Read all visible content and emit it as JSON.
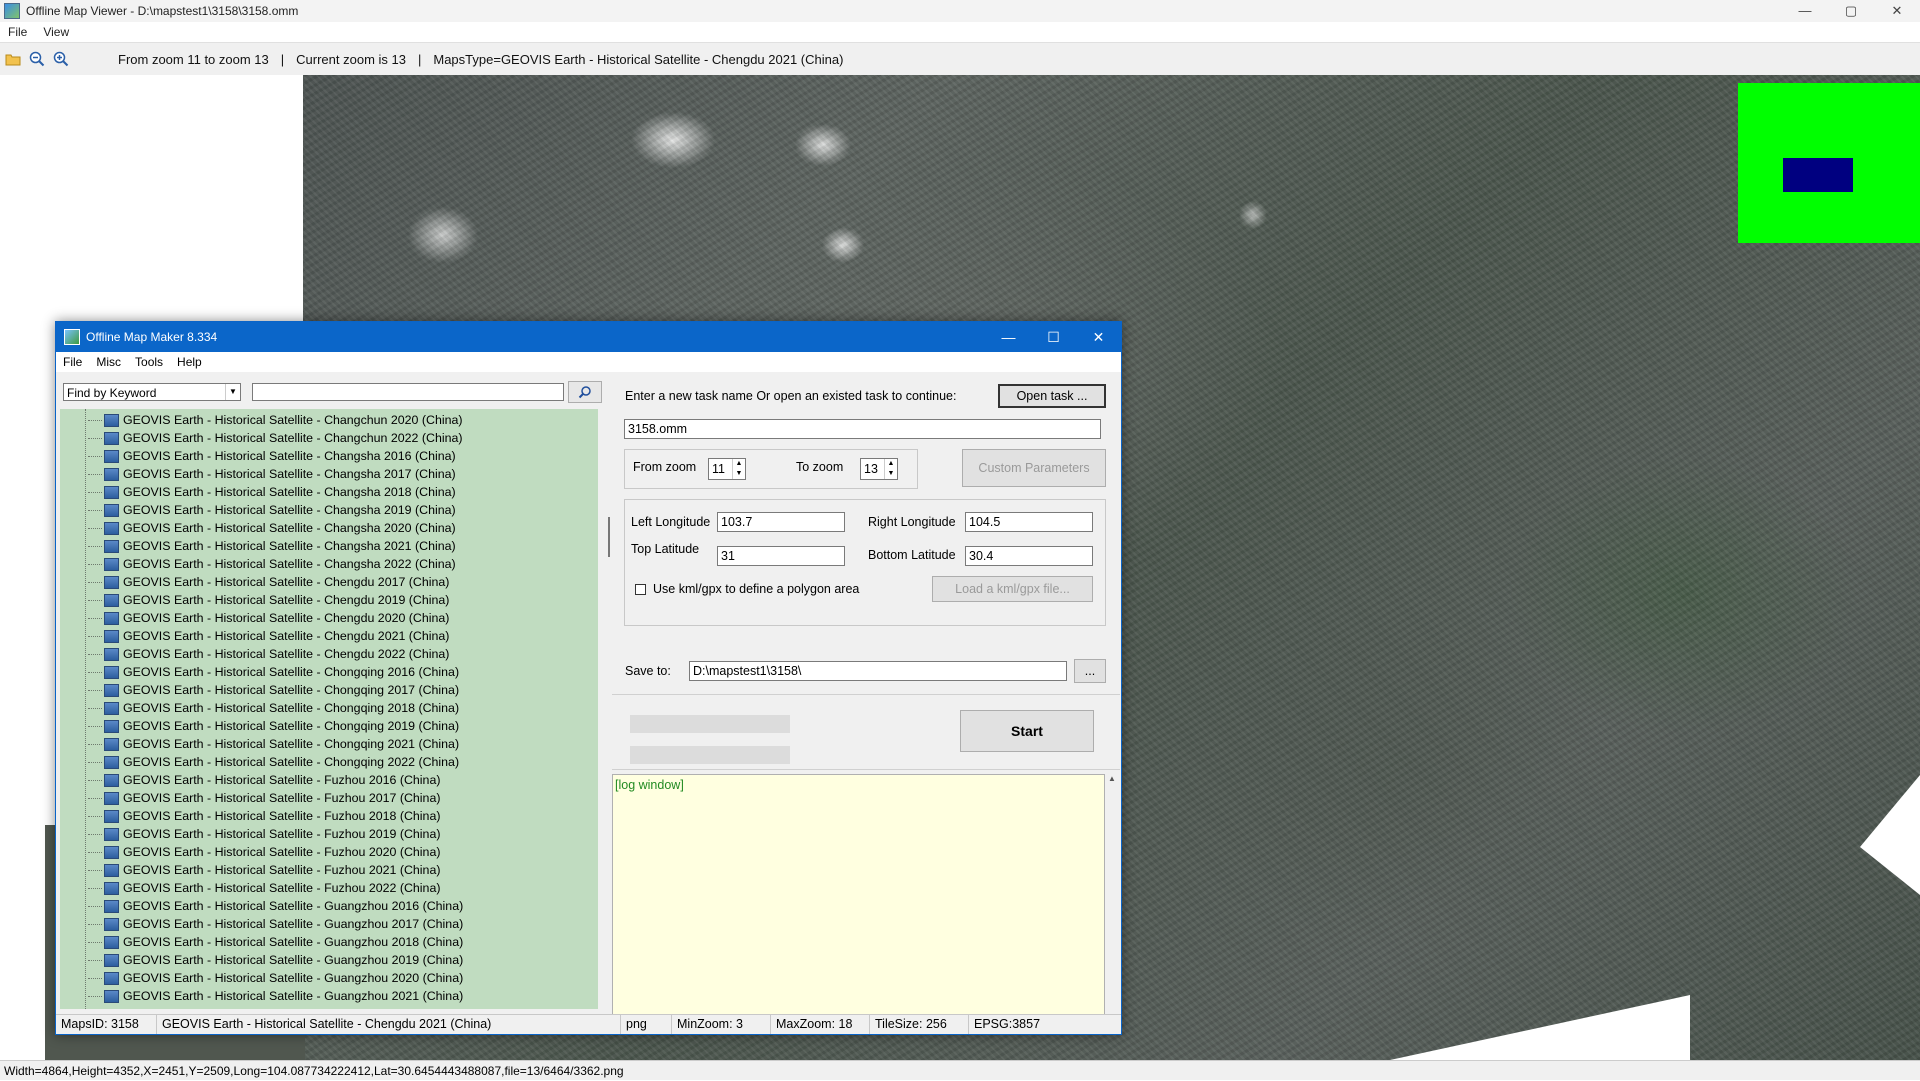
{
  "viewer": {
    "title": "Offline Map Viewer - D:\\mapstest1\\3158\\3158.omm",
    "menu": [
      "File",
      "View"
    ],
    "window_controls": {
      "minimize": "—",
      "maximize": "▢",
      "close": "✕"
    },
    "toolbar": {
      "zoom_range": "From zoom 11 to zoom 13",
      "current_zoom": "Current zoom is 13",
      "maps_type": "MapsType=GEOVIS Earth - Historical Satellite - Chengdu 2021 (China)",
      "separator": "|"
    },
    "status": "Width=4864,Height=4352,X=2451,Y=2509,Long=104.087734222412,Lat=30.6454443488087,file=13/6464/3362.png",
    "overview_colors": {
      "background": "#00ff00",
      "viewport": "#000080"
    }
  },
  "maker": {
    "title": "Offline Map Maker 8.334",
    "menu": [
      "File",
      "Misc",
      "Tools",
      "Help"
    ],
    "window_controls": {
      "minimize": "—",
      "maximize": "☐",
      "close": "✕"
    },
    "search": {
      "mode": "Find by Keyword",
      "query": ""
    },
    "map_list": [
      "GEOVIS Earth - Historical Satellite - Changchun 2020 (China)",
      "GEOVIS Earth - Historical Satellite - Changchun 2022 (China)",
      "GEOVIS Earth - Historical Satellite - Changsha 2016 (China)",
      "GEOVIS Earth - Historical Satellite - Changsha 2017 (China)",
      "GEOVIS Earth - Historical Satellite - Changsha 2018 (China)",
      "GEOVIS Earth - Historical Satellite - Changsha 2019 (China)",
      "GEOVIS Earth - Historical Satellite - Changsha 2020 (China)",
      "GEOVIS Earth - Historical Satellite - Changsha 2021 (China)",
      "GEOVIS Earth - Historical Satellite - Changsha 2022 (China)",
      "GEOVIS Earth - Historical Satellite - Chengdu 2017 (China)",
      "GEOVIS Earth - Historical Satellite - Chengdu 2019 (China)",
      "GEOVIS Earth - Historical Satellite - Chengdu 2020 (China)",
      "GEOVIS Earth - Historical Satellite - Chengdu 2021 (China)",
      "GEOVIS Earth - Historical Satellite - Chengdu 2022 (China)",
      "GEOVIS Earth - Historical Satellite - Chongqing 2016 (China)",
      "GEOVIS Earth - Historical Satellite - Chongqing 2017 (China)",
      "GEOVIS Earth - Historical Satellite - Chongqing 2018 (China)",
      "GEOVIS Earth - Historical Satellite - Chongqing 2019 (China)",
      "GEOVIS Earth - Historical Satellite - Chongqing 2021 (China)",
      "GEOVIS Earth - Historical Satellite - Chongqing 2022 (China)",
      "GEOVIS Earth - Historical Satellite - Fuzhou 2016 (China)",
      "GEOVIS Earth - Historical Satellite - Fuzhou 2017 (China)",
      "GEOVIS Earth - Historical Satellite - Fuzhou 2018 (China)",
      "GEOVIS Earth - Historical Satellite - Fuzhou 2019 (China)",
      "GEOVIS Earth - Historical Satellite - Fuzhou 2020 (China)",
      "GEOVIS Earth - Historical Satellite - Fuzhou 2021 (China)",
      "GEOVIS Earth - Historical Satellite - Fuzhou 2022 (China)",
      "GEOVIS Earth - Historical Satellite - Guangzhou 2016 (China)",
      "GEOVIS Earth - Historical Satellite - Guangzhou 2017 (China)",
      "GEOVIS Earth - Historical Satellite - Guangzhou 2018 (China)",
      "GEOVIS Earth - Historical Satellite - Guangzhou 2019 (China)",
      "GEOVIS Earth - Historical Satellite - Guangzhou 2020 (China)",
      "GEOVIS Earth - Historical Satellite - Guangzhou 2021 (China)"
    ],
    "task": {
      "prompt": "Enter a new task name Or open an existed task to continue:",
      "open_button": "Open task ...",
      "name": "3158.omm"
    },
    "zoom": {
      "from_label": "From zoom",
      "from_value": "11",
      "to_label": "To zoom",
      "to_value": "13",
      "custom_button": "Custom Parameters"
    },
    "bounds": {
      "left_lon_label": "Left Longitude",
      "left_lon": "103.7",
      "right_lon_label": "Right Longitude",
      "right_lon": "104.5",
      "top_lat_label": "Top Latitude",
      "top_lat": "31",
      "bottom_lat_label": "Bottom Latitude",
      "bottom_lat": "30.4",
      "kml_label": "Use kml/gpx to define a polygon area",
      "kml_button": "Load a kml/gpx file..."
    },
    "save": {
      "label": "Save to:",
      "path": "D:\\mapstest1\\3158\\",
      "browse": "..."
    },
    "start_button": "Start",
    "log": "[log window]",
    "status": {
      "maps_id": "MapsID: 3158",
      "map_name": "GEOVIS Earth - Historical Satellite - Chengdu 2021 (China)",
      "format": "png",
      "min_zoom": "MinZoom: 3",
      "max_zoom": "MaxZoom: 18",
      "tile_size": "TileSize: 256",
      "epsg": "EPSG:3857"
    }
  }
}
